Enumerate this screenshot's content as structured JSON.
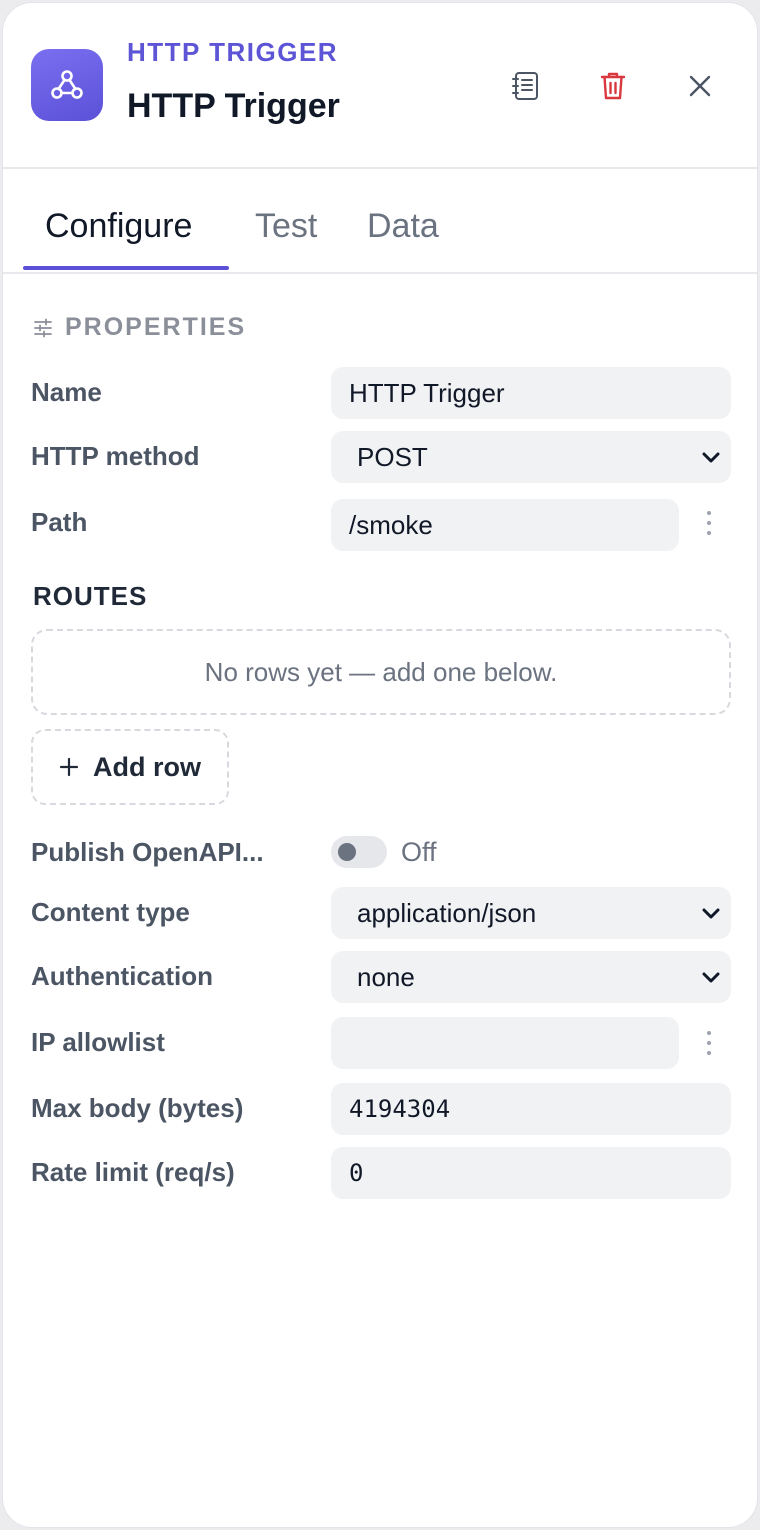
{
  "header": {
    "kicker": "HTTP TRIGGER",
    "title": "HTTP Trigger",
    "icon": "webhook-icon",
    "accent": "#5b51d8",
    "delete_color": "#d9383f"
  },
  "tabs": [
    {
      "label": "Configure",
      "active": true
    },
    {
      "label": "Test",
      "active": false
    },
    {
      "label": "Data",
      "active": false
    }
  ],
  "properties": {
    "section_label": "PROPERTIES",
    "name": {
      "label": "Name",
      "value": "HTTP Trigger"
    },
    "http_method": {
      "label": "HTTP method",
      "value": "POST"
    },
    "path": {
      "label": "Path",
      "value": "/smoke"
    },
    "routes": {
      "title": "ROUTES",
      "empty_text": "No rows yet — add one below.",
      "add_label": "Add row"
    },
    "publish_openapi": {
      "label": "Publish OpenAPI...",
      "state": "Off",
      "enabled": false
    },
    "content_type": {
      "label": "Content type",
      "value": "application/json"
    },
    "authentication": {
      "label": "Authentication",
      "value": "none"
    },
    "ip_allowlist": {
      "label": "IP allowlist",
      "value": ""
    },
    "max_body": {
      "label": "Max body (bytes)",
      "value": "4194304"
    },
    "rate_limit": {
      "label": "Rate limit (req/s)",
      "value": "0"
    }
  }
}
